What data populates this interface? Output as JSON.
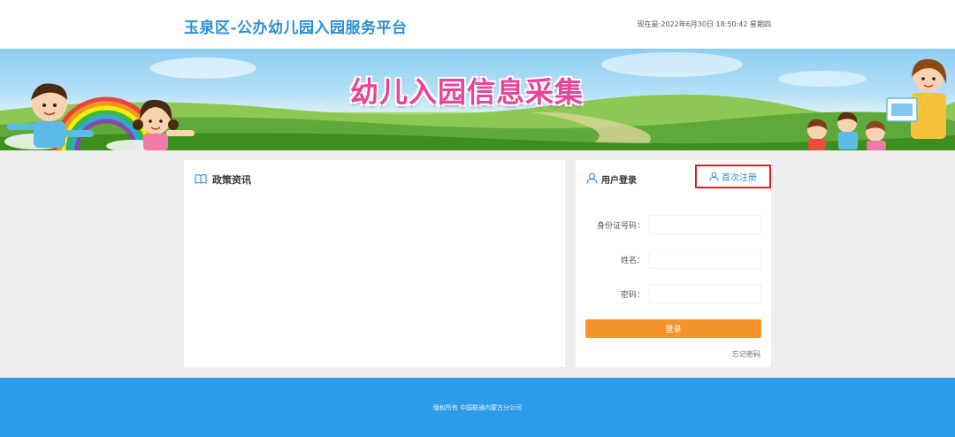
{
  "header": {
    "site_title": "玉泉区-公办幼儿园入园服务平台",
    "datetime": "现在是:2022年6月30日 18:50:42 星期四"
  },
  "banner": {
    "title": "幼儿入园信息采集"
  },
  "policy": {
    "title": "政策资讯",
    "icon": "book-icon"
  },
  "login": {
    "title": "用户登录",
    "icon": "user-icon",
    "register_label": "首次注册",
    "id_label": "身份证号码：",
    "name_label": "姓名：",
    "password_label": "密码：",
    "submit_label": "登录",
    "forgot_label": "忘记密码"
  },
  "footer": {
    "copyright": "版权所有 中国联通内蒙古分公司"
  },
  "colors": {
    "brand_blue": "#2b8fd6",
    "footer_blue": "#2e9be8",
    "login_orange": "#f5942b",
    "highlight_red": "#e02020",
    "banner_pink": "#e8449a"
  }
}
